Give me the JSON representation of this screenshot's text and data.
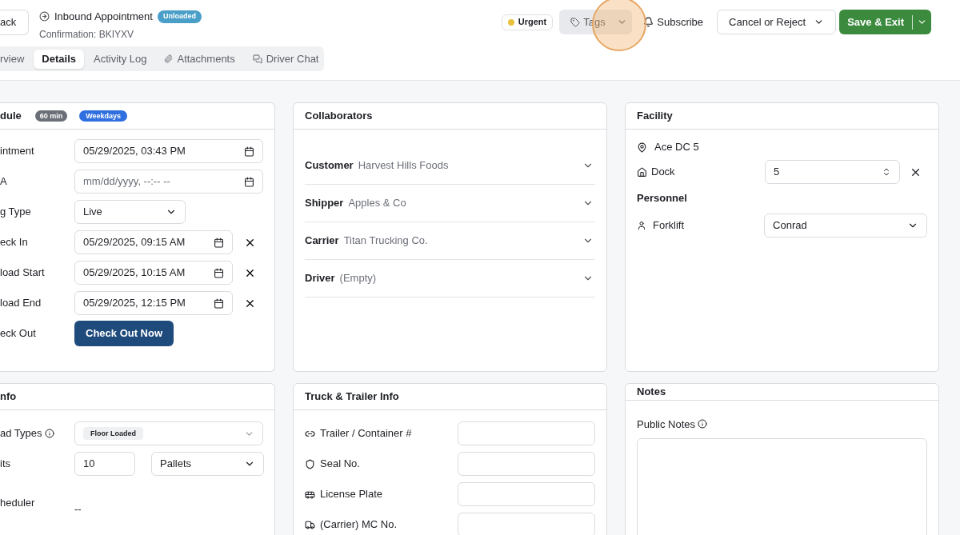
{
  "header": {
    "back_button": "ack",
    "title": "Inbound Appointment",
    "status_badge": "Unloaded",
    "confirmation": "Confirmation: BKIYXV",
    "actions": {
      "priority": "Urgent",
      "tags": "Tags",
      "subscribe": "Subscribe",
      "cancel": "Cancel or Reject",
      "save": "Save & Exit"
    }
  },
  "tabs": [
    {
      "label": "rview",
      "selected": false
    },
    {
      "label": "Details",
      "selected": true
    },
    {
      "label": "Activity Log",
      "selected": false
    },
    {
      "label": "Attachments",
      "selected": false
    },
    {
      "label": "Driver Chat",
      "selected": false
    }
  ],
  "schedule": {
    "title": "dule",
    "duration_badge": "60 min",
    "days_badge": "Weekdays",
    "rows": [
      {
        "kind": "datetime",
        "label": "intment",
        "value": "05/29/2025, 03:43 PM",
        "clearable": false
      },
      {
        "kind": "datetime",
        "label": "A",
        "placeholder": "mm/dd/yyyy, --:-- --",
        "clearable": false
      },
      {
        "kind": "select",
        "label": "g Type",
        "value": "Live"
      },
      {
        "kind": "datetime",
        "label": "eck In",
        "value": "05/29/2025, 09:15 AM",
        "clearable": true
      },
      {
        "kind": "datetime",
        "label": "load Start",
        "value": "05/29/2025, 10:15 AM",
        "clearable": true
      },
      {
        "kind": "datetime",
        "label": "load End",
        "value": "05/29/2025, 12:15 PM",
        "clearable": true
      },
      {
        "kind": "button",
        "label": "eck Out",
        "value": "Check Out Now"
      }
    ]
  },
  "collaborators": {
    "title": "Collaborators",
    "items": [
      {
        "role": "Customer",
        "name": "Harvest Hills Foods"
      },
      {
        "role": "Shipper",
        "name": "Apples & Co"
      },
      {
        "role": "Carrier",
        "name": "Titan Trucking Co."
      },
      {
        "role": "Driver",
        "name": "(Empty)"
      }
    ]
  },
  "facility": {
    "title": "Facility",
    "location": "Ace DC 5",
    "dock_label": "Dock",
    "dock_value": "5",
    "personnel_title": "Personnel",
    "personnel": [
      {
        "label": "Forklift",
        "value": "Conrad"
      }
    ]
  },
  "info": {
    "title": "nfo",
    "load_types_label": "ad Types",
    "load_type_tag": "Floor Loaded",
    "units_label": "its",
    "units_value": "10",
    "units_type": "Pallets",
    "scheduler_label": "heduler",
    "scheduler_value": "--"
  },
  "truck": {
    "title": "Truck & Trailer Info",
    "fields": [
      {
        "label": "Trailer / Container #"
      },
      {
        "label": "Seal No."
      },
      {
        "label": "License Plate"
      },
      {
        "label": "(Carrier) MC No."
      }
    ]
  },
  "notes": {
    "title": "Notes",
    "public_label": "Public Notes"
  }
}
